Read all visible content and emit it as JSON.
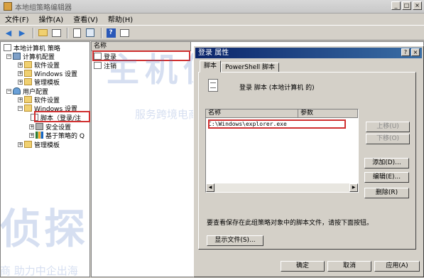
{
  "window": {
    "title": "本地组策略编辑器",
    "controls": [
      "_",
      "□",
      "×"
    ]
  },
  "menu": [
    "文件(F)",
    "操作(A)",
    "查看(V)",
    "帮助(H)"
  ],
  "toolbar": {
    "icons": [
      "back-icon",
      "forward-icon",
      "up-folder-icon",
      "show-hide-tree-icon",
      "properties-icon",
      "export-list-icon",
      "help-icon",
      "console-icon"
    ]
  },
  "tree": {
    "root": "本地计算机 策略",
    "computer": {
      "label": "计算机配置",
      "children": [
        "软件设置",
        "Windows 设置",
        "管理模板"
      ]
    },
    "user": {
      "label": "用户配置",
      "children": [
        "软件设置",
        "Windows 设置",
        "管理模板"
      ],
      "windows_children": [
        "脚本（登录/注",
        "安全设置",
        "基于策略的 Q"
      ]
    }
  },
  "list": {
    "header": "名称",
    "items": [
      "登录",
      "注销"
    ]
  },
  "dialog": {
    "title": "登录 属性",
    "help": "?",
    "close": "×",
    "tabs": [
      "脚本",
      "PowerShell 脚本"
    ],
    "caption": "登录 脚本 (本地计算机 的)",
    "columns": [
      "名称",
      "参数"
    ],
    "entry": "C:\\Windows\\explorer.exe",
    "buttons": {
      "up": "上移(U)",
      "down": "下移(O)",
      "add": "添加(D)...",
      "edit": "编辑(E)...",
      "remove": "删除(R)"
    },
    "hint": "要查看保存在此组策略对象中的脚本文件，请按下面按钮。",
    "show_files": "显示文件(S)...",
    "ok": "确定",
    "cancel": "取消",
    "apply": "应用(A)"
  },
  "watermark": {
    "brand": "主机侦探",
    "slogan": "服务跨境电商 助力中企出海",
    "slogan_bottom": "商 助力中企出海",
    "brand_bottom": "侦探"
  },
  "colors": {
    "highlight_red": "#d03030",
    "dialog_title": "#0a246a"
  }
}
